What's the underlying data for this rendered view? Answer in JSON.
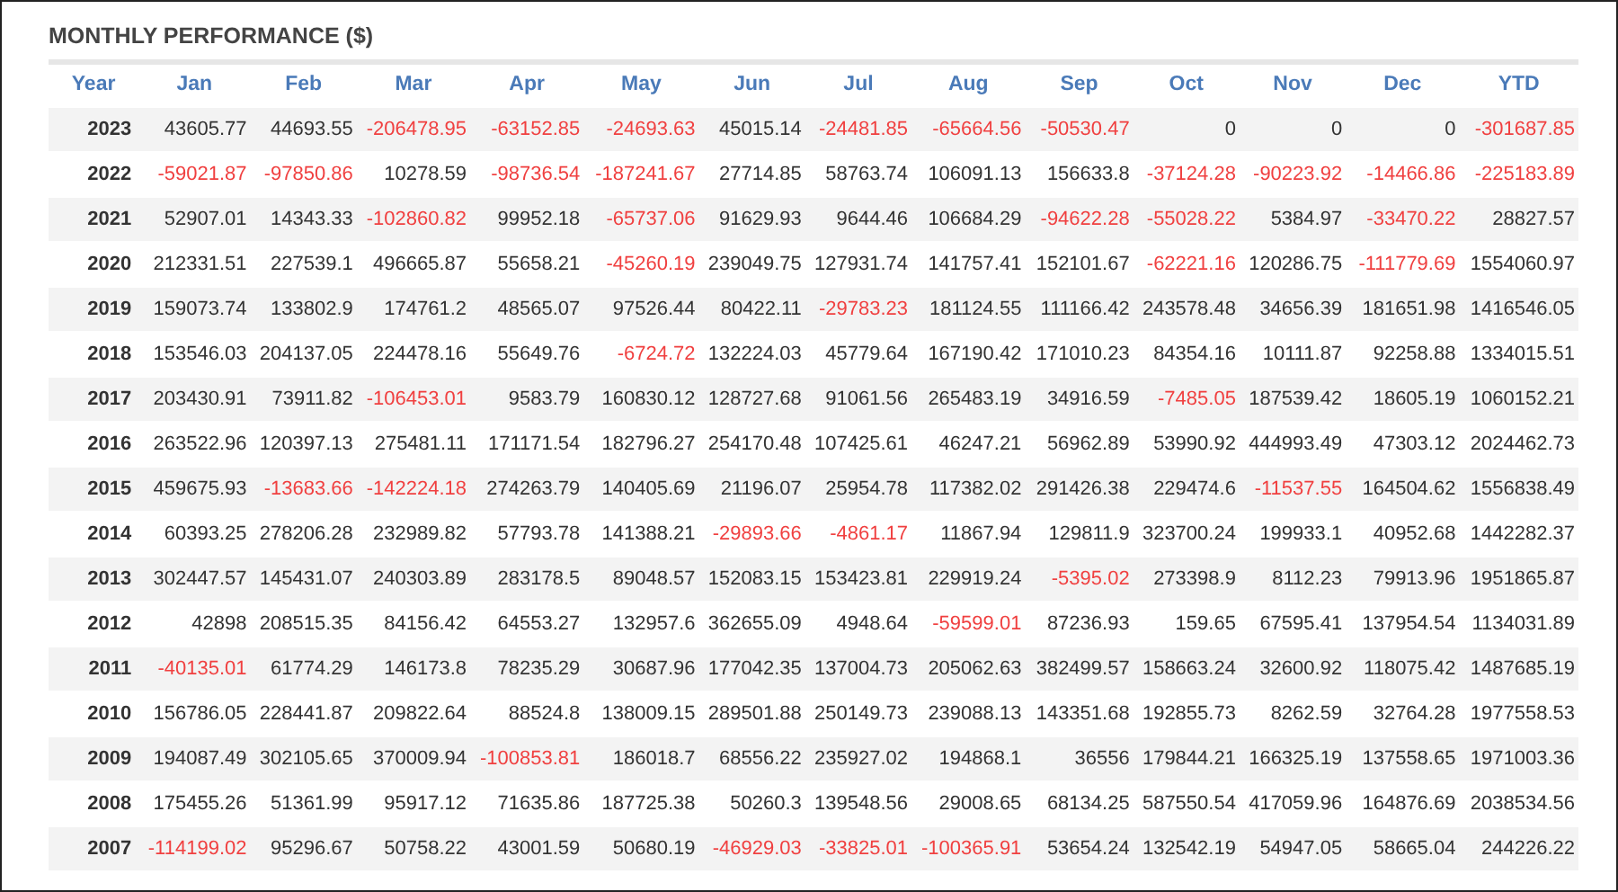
{
  "title": "MONTHLY PERFORMANCE ($)",
  "table": {
    "columns": [
      "Year",
      "Jan",
      "Feb",
      "Mar",
      "Apr",
      "May",
      "Jun",
      "Jul",
      "Aug",
      "Sep",
      "Oct",
      "Nov",
      "Dec",
      "YTD"
    ],
    "rows": [
      {
        "cells": [
          {
            "kind": "year",
            "value": "2023"
          },
          {
            "kind": "amount",
            "value": "43605.77",
            "negative": false
          },
          {
            "kind": "amount",
            "value": "44693.55",
            "negative": false
          },
          {
            "kind": "amount",
            "value": "-206478.95",
            "negative": true
          },
          {
            "kind": "amount",
            "value": "-63152.85",
            "negative": true
          },
          {
            "kind": "amount",
            "value": "-24693.63",
            "negative": true
          },
          {
            "kind": "amount",
            "value": "45015.14",
            "negative": false
          },
          {
            "kind": "amount",
            "value": "-24481.85",
            "negative": true
          },
          {
            "kind": "amount",
            "value": "-65664.56",
            "negative": true
          },
          {
            "kind": "amount",
            "value": "-50530.47",
            "negative": true
          },
          {
            "kind": "amount",
            "value": "0",
            "negative": false
          },
          {
            "kind": "amount",
            "value": "0",
            "negative": false
          },
          {
            "kind": "amount",
            "value": "0",
            "negative": false
          },
          {
            "kind": "amount",
            "value": "-301687.85",
            "negative": true
          }
        ]
      },
      {
        "cells": [
          {
            "kind": "year",
            "value": "2022"
          },
          {
            "kind": "amount",
            "value": "-59021.87",
            "negative": true
          },
          {
            "kind": "amount",
            "value": "-97850.86",
            "negative": true
          },
          {
            "kind": "amount",
            "value": "10278.59",
            "negative": false
          },
          {
            "kind": "amount",
            "value": "-98736.54",
            "negative": true
          },
          {
            "kind": "amount",
            "value": "-187241.67",
            "negative": true
          },
          {
            "kind": "amount",
            "value": "27714.85",
            "negative": false
          },
          {
            "kind": "amount",
            "value": "58763.74",
            "negative": false
          },
          {
            "kind": "amount",
            "value": "106091.13",
            "negative": false
          },
          {
            "kind": "amount",
            "value": "156633.8",
            "negative": false
          },
          {
            "kind": "amount",
            "value": "-37124.28",
            "negative": true
          },
          {
            "kind": "amount",
            "value": "-90223.92",
            "negative": true
          },
          {
            "kind": "amount",
            "value": "-14466.86",
            "negative": true
          },
          {
            "kind": "amount",
            "value": "-225183.89",
            "negative": true
          }
        ]
      },
      {
        "cells": [
          {
            "kind": "year",
            "value": "2021"
          },
          {
            "kind": "amount",
            "value": "52907.01",
            "negative": false
          },
          {
            "kind": "amount",
            "value": "14343.33",
            "negative": false
          },
          {
            "kind": "amount",
            "value": "-102860.82",
            "negative": true
          },
          {
            "kind": "amount",
            "value": "99952.18",
            "negative": false
          },
          {
            "kind": "amount",
            "value": "-65737.06",
            "negative": true
          },
          {
            "kind": "amount",
            "value": "91629.93",
            "negative": false
          },
          {
            "kind": "amount",
            "value": "9644.46",
            "negative": false
          },
          {
            "kind": "amount",
            "value": "106684.29",
            "negative": false
          },
          {
            "kind": "amount",
            "value": "-94622.28",
            "negative": true
          },
          {
            "kind": "amount",
            "value": "-55028.22",
            "negative": true
          },
          {
            "kind": "amount",
            "value": "5384.97",
            "negative": false
          },
          {
            "kind": "amount",
            "value": "-33470.22",
            "negative": true
          },
          {
            "kind": "amount",
            "value": "28827.57",
            "negative": false
          }
        ]
      },
      {
        "cells": [
          {
            "kind": "year",
            "value": "2020"
          },
          {
            "kind": "amount",
            "value": "212331.51",
            "negative": false
          },
          {
            "kind": "amount",
            "value": "227539.1",
            "negative": false
          },
          {
            "kind": "amount",
            "value": "496665.87",
            "negative": false
          },
          {
            "kind": "amount",
            "value": "55658.21",
            "negative": false
          },
          {
            "kind": "amount",
            "value": "-45260.19",
            "negative": true
          },
          {
            "kind": "amount",
            "value": "239049.75",
            "negative": false
          },
          {
            "kind": "amount",
            "value": "127931.74",
            "negative": false
          },
          {
            "kind": "amount",
            "value": "141757.41",
            "negative": false
          },
          {
            "kind": "amount",
            "value": "152101.67",
            "negative": false
          },
          {
            "kind": "amount",
            "value": "-62221.16",
            "negative": true
          },
          {
            "kind": "amount",
            "value": "120286.75",
            "negative": false
          },
          {
            "kind": "amount",
            "value": "-111779.69",
            "negative": true
          },
          {
            "kind": "amount",
            "value": "1554060.97",
            "negative": false
          }
        ]
      },
      {
        "cells": [
          {
            "kind": "year",
            "value": "2019"
          },
          {
            "kind": "amount",
            "value": "159073.74",
            "negative": false
          },
          {
            "kind": "amount",
            "value": "133802.9",
            "negative": false
          },
          {
            "kind": "amount",
            "value": "174761.2",
            "negative": false
          },
          {
            "kind": "amount",
            "value": "48565.07",
            "negative": false
          },
          {
            "kind": "amount",
            "value": "97526.44",
            "negative": false
          },
          {
            "kind": "amount",
            "value": "80422.11",
            "negative": false
          },
          {
            "kind": "amount",
            "value": "-29783.23",
            "negative": true
          },
          {
            "kind": "amount",
            "value": "181124.55",
            "negative": false
          },
          {
            "kind": "amount",
            "value": "111166.42",
            "negative": false
          },
          {
            "kind": "amount",
            "value": "243578.48",
            "negative": false
          },
          {
            "kind": "amount",
            "value": "34656.39",
            "negative": false
          },
          {
            "kind": "amount",
            "value": "181651.98",
            "negative": false
          },
          {
            "kind": "amount",
            "value": "1416546.05",
            "negative": false
          }
        ]
      },
      {
        "cells": [
          {
            "kind": "year",
            "value": "2018"
          },
          {
            "kind": "amount",
            "value": "153546.03",
            "negative": false
          },
          {
            "kind": "amount",
            "value": "204137.05",
            "negative": false
          },
          {
            "kind": "amount",
            "value": "224478.16",
            "negative": false
          },
          {
            "kind": "amount",
            "value": "55649.76",
            "negative": false
          },
          {
            "kind": "amount",
            "value": "-6724.72",
            "negative": true
          },
          {
            "kind": "amount",
            "value": "132224.03",
            "negative": false
          },
          {
            "kind": "amount",
            "value": "45779.64",
            "negative": false
          },
          {
            "kind": "amount",
            "value": "167190.42",
            "negative": false
          },
          {
            "kind": "amount",
            "value": "171010.23",
            "negative": false
          },
          {
            "kind": "amount",
            "value": "84354.16",
            "negative": false
          },
          {
            "kind": "amount",
            "value": "10111.87",
            "negative": false
          },
          {
            "kind": "amount",
            "value": "92258.88",
            "negative": false
          },
          {
            "kind": "amount",
            "value": "1334015.51",
            "negative": false
          }
        ]
      },
      {
        "cells": [
          {
            "kind": "year",
            "value": "2017"
          },
          {
            "kind": "amount",
            "value": "203430.91",
            "negative": false
          },
          {
            "kind": "amount",
            "value": "73911.82",
            "negative": false
          },
          {
            "kind": "amount",
            "value": "-106453.01",
            "negative": true
          },
          {
            "kind": "amount",
            "value": "9583.79",
            "negative": false
          },
          {
            "kind": "amount",
            "value": "160830.12",
            "negative": false
          },
          {
            "kind": "amount",
            "value": "128727.68",
            "negative": false
          },
          {
            "kind": "amount",
            "value": "91061.56",
            "negative": false
          },
          {
            "kind": "amount",
            "value": "265483.19",
            "negative": false
          },
          {
            "kind": "amount",
            "value": "34916.59",
            "negative": false
          },
          {
            "kind": "amount",
            "value": "-7485.05",
            "negative": true
          },
          {
            "kind": "amount",
            "value": "187539.42",
            "negative": false
          },
          {
            "kind": "amount",
            "value": "18605.19",
            "negative": false
          },
          {
            "kind": "amount",
            "value": "1060152.21",
            "negative": false
          }
        ]
      },
      {
        "cells": [
          {
            "kind": "year",
            "value": "2016"
          },
          {
            "kind": "amount",
            "value": "263522.96",
            "negative": false
          },
          {
            "kind": "amount",
            "value": "120397.13",
            "negative": false
          },
          {
            "kind": "amount",
            "value": "275481.11",
            "negative": false
          },
          {
            "kind": "amount",
            "value": "171171.54",
            "negative": false
          },
          {
            "kind": "amount",
            "value": "182796.27",
            "negative": false
          },
          {
            "kind": "amount",
            "value": "254170.48",
            "negative": false
          },
          {
            "kind": "amount",
            "value": "107425.61",
            "negative": false
          },
          {
            "kind": "amount",
            "value": "46247.21",
            "negative": false
          },
          {
            "kind": "amount",
            "value": "56962.89",
            "negative": false
          },
          {
            "kind": "amount",
            "value": "53990.92",
            "negative": false
          },
          {
            "kind": "amount",
            "value": "444993.49",
            "negative": false
          },
          {
            "kind": "amount",
            "value": "47303.12",
            "negative": false
          },
          {
            "kind": "amount",
            "value": "2024462.73",
            "negative": false
          }
        ]
      },
      {
        "cells": [
          {
            "kind": "year",
            "value": "2015"
          },
          {
            "kind": "amount",
            "value": "459675.93",
            "negative": false
          },
          {
            "kind": "amount",
            "value": "-13683.66",
            "negative": true
          },
          {
            "kind": "amount",
            "value": "-142224.18",
            "negative": true
          },
          {
            "kind": "amount",
            "value": "274263.79",
            "negative": false
          },
          {
            "kind": "amount",
            "value": "140405.69",
            "negative": false
          },
          {
            "kind": "amount",
            "value": "21196.07",
            "negative": false
          },
          {
            "kind": "amount",
            "value": "25954.78",
            "negative": false
          },
          {
            "kind": "amount",
            "value": "117382.02",
            "negative": false
          },
          {
            "kind": "amount",
            "value": "291426.38",
            "negative": false
          },
          {
            "kind": "amount",
            "value": "229474.6",
            "negative": false
          },
          {
            "kind": "amount",
            "value": "-11537.55",
            "negative": true
          },
          {
            "kind": "amount",
            "value": "164504.62",
            "negative": false
          },
          {
            "kind": "amount",
            "value": "1556838.49",
            "negative": false
          }
        ]
      },
      {
        "cells": [
          {
            "kind": "year",
            "value": "2014"
          },
          {
            "kind": "amount",
            "value": "60393.25",
            "negative": false
          },
          {
            "kind": "amount",
            "value": "278206.28",
            "negative": false
          },
          {
            "kind": "amount",
            "value": "232989.82",
            "negative": false
          },
          {
            "kind": "amount",
            "value": "57793.78",
            "negative": false
          },
          {
            "kind": "amount",
            "value": "141388.21",
            "negative": false
          },
          {
            "kind": "amount",
            "value": "-29893.66",
            "negative": true
          },
          {
            "kind": "amount",
            "value": "-4861.17",
            "negative": true
          },
          {
            "kind": "amount",
            "value": "11867.94",
            "negative": false
          },
          {
            "kind": "amount",
            "value": "129811.9",
            "negative": false
          },
          {
            "kind": "amount",
            "value": "323700.24",
            "negative": false
          },
          {
            "kind": "amount",
            "value": "199933.1",
            "negative": false
          },
          {
            "kind": "amount",
            "value": "40952.68",
            "negative": false
          },
          {
            "kind": "amount",
            "value": "1442282.37",
            "negative": false
          }
        ]
      },
      {
        "cells": [
          {
            "kind": "year",
            "value": "2013"
          },
          {
            "kind": "amount",
            "value": "302447.57",
            "negative": false
          },
          {
            "kind": "amount",
            "value": "145431.07",
            "negative": false
          },
          {
            "kind": "amount",
            "value": "240303.89",
            "negative": false
          },
          {
            "kind": "amount",
            "value": "283178.5",
            "negative": false
          },
          {
            "kind": "amount",
            "value": "89048.57",
            "negative": false
          },
          {
            "kind": "amount",
            "value": "152083.15",
            "negative": false
          },
          {
            "kind": "amount",
            "value": "153423.81",
            "negative": false
          },
          {
            "kind": "amount",
            "value": "229919.24",
            "negative": false
          },
          {
            "kind": "amount",
            "value": "-5395.02",
            "negative": true
          },
          {
            "kind": "amount",
            "value": "273398.9",
            "negative": false
          },
          {
            "kind": "amount",
            "value": "8112.23",
            "negative": false
          },
          {
            "kind": "amount",
            "value": "79913.96",
            "negative": false
          },
          {
            "kind": "amount",
            "value": "1951865.87",
            "negative": false
          }
        ]
      },
      {
        "cells": [
          {
            "kind": "year",
            "value": "2012"
          },
          {
            "kind": "amount",
            "value": "42898",
            "negative": false
          },
          {
            "kind": "amount",
            "value": "208515.35",
            "negative": false
          },
          {
            "kind": "amount",
            "value": "84156.42",
            "negative": false
          },
          {
            "kind": "amount",
            "value": "64553.27",
            "negative": false
          },
          {
            "kind": "amount",
            "value": "132957.6",
            "negative": false
          },
          {
            "kind": "amount",
            "value": "362655.09",
            "negative": false
          },
          {
            "kind": "amount",
            "value": "4948.64",
            "negative": false
          },
          {
            "kind": "amount",
            "value": "-59599.01",
            "negative": true
          },
          {
            "kind": "amount",
            "value": "87236.93",
            "negative": false
          },
          {
            "kind": "amount",
            "value": "159.65",
            "negative": false
          },
          {
            "kind": "amount",
            "value": "67595.41",
            "negative": false
          },
          {
            "kind": "amount",
            "value": "137954.54",
            "negative": false
          },
          {
            "kind": "amount",
            "value": "1134031.89",
            "negative": false
          }
        ]
      },
      {
        "cells": [
          {
            "kind": "year",
            "value": "2011"
          },
          {
            "kind": "amount",
            "value": "-40135.01",
            "negative": true
          },
          {
            "kind": "amount",
            "value": "61774.29",
            "negative": false
          },
          {
            "kind": "amount",
            "value": "146173.8",
            "negative": false
          },
          {
            "kind": "amount",
            "value": "78235.29",
            "negative": false
          },
          {
            "kind": "amount",
            "value": "30687.96",
            "negative": false
          },
          {
            "kind": "amount",
            "value": "177042.35",
            "negative": false
          },
          {
            "kind": "amount",
            "value": "137004.73",
            "negative": false
          },
          {
            "kind": "amount",
            "value": "205062.63",
            "negative": false
          },
          {
            "kind": "amount",
            "value": "382499.57",
            "negative": false
          },
          {
            "kind": "amount",
            "value": "158663.24",
            "negative": false
          },
          {
            "kind": "amount",
            "value": "32600.92",
            "negative": false
          },
          {
            "kind": "amount",
            "value": "118075.42",
            "negative": false
          },
          {
            "kind": "amount",
            "value": "1487685.19",
            "negative": false
          }
        ]
      },
      {
        "cells": [
          {
            "kind": "year",
            "value": "2010"
          },
          {
            "kind": "amount",
            "value": "156786.05",
            "negative": false
          },
          {
            "kind": "amount",
            "value": "228441.87",
            "negative": false
          },
          {
            "kind": "amount",
            "value": "209822.64",
            "negative": false
          },
          {
            "kind": "amount",
            "value": "88524.8",
            "negative": false
          },
          {
            "kind": "amount",
            "value": "138009.15",
            "negative": false
          },
          {
            "kind": "amount",
            "value": "289501.88",
            "negative": false
          },
          {
            "kind": "amount",
            "value": "250149.73",
            "negative": false
          },
          {
            "kind": "amount",
            "value": "239088.13",
            "negative": false
          },
          {
            "kind": "amount",
            "value": "143351.68",
            "negative": false
          },
          {
            "kind": "amount",
            "value": "192855.73",
            "negative": false
          },
          {
            "kind": "amount",
            "value": "8262.59",
            "negative": false
          },
          {
            "kind": "amount",
            "value": "32764.28",
            "negative": false
          },
          {
            "kind": "amount",
            "value": "1977558.53",
            "negative": false
          }
        ]
      },
      {
        "cells": [
          {
            "kind": "year",
            "value": "2009"
          },
          {
            "kind": "amount",
            "value": "194087.49",
            "negative": false
          },
          {
            "kind": "amount",
            "value": "302105.65",
            "negative": false
          },
          {
            "kind": "amount",
            "value": "370009.94",
            "negative": false
          },
          {
            "kind": "amount",
            "value": "-100853.81",
            "negative": true
          },
          {
            "kind": "amount",
            "value": "186018.7",
            "negative": false
          },
          {
            "kind": "amount",
            "value": "68556.22",
            "negative": false
          },
          {
            "kind": "amount",
            "value": "235927.02",
            "negative": false
          },
          {
            "kind": "amount",
            "value": "194868.1",
            "negative": false
          },
          {
            "kind": "amount",
            "value": "36556",
            "negative": false
          },
          {
            "kind": "amount",
            "value": "179844.21",
            "negative": false
          },
          {
            "kind": "amount",
            "value": "166325.19",
            "negative": false
          },
          {
            "kind": "amount",
            "value": "137558.65",
            "negative": false
          },
          {
            "kind": "amount",
            "value": "1971003.36",
            "negative": false
          }
        ]
      },
      {
        "cells": [
          {
            "kind": "year",
            "value": "2008"
          },
          {
            "kind": "amount",
            "value": "175455.26",
            "negative": false
          },
          {
            "kind": "amount",
            "value": "51361.99",
            "negative": false
          },
          {
            "kind": "amount",
            "value": "95917.12",
            "negative": false
          },
          {
            "kind": "amount",
            "value": "71635.86",
            "negative": false
          },
          {
            "kind": "amount",
            "value": "187725.38",
            "negative": false
          },
          {
            "kind": "amount",
            "value": "50260.3",
            "negative": false
          },
          {
            "kind": "amount",
            "value": "139548.56",
            "negative": false
          },
          {
            "kind": "amount",
            "value": "29008.65",
            "negative": false
          },
          {
            "kind": "amount",
            "value": "68134.25",
            "negative": false
          },
          {
            "kind": "amount",
            "value": "587550.54",
            "negative": false
          },
          {
            "kind": "amount",
            "value": "417059.96",
            "negative": false
          },
          {
            "kind": "amount",
            "value": "164876.69",
            "negative": false
          },
          {
            "kind": "amount",
            "value": "2038534.56",
            "negative": false
          }
        ]
      },
      {
        "cells": [
          {
            "kind": "year",
            "value": "2007"
          },
          {
            "kind": "amount",
            "value": "-114199.02",
            "negative": true
          },
          {
            "kind": "amount",
            "value": "95296.67",
            "negative": false
          },
          {
            "kind": "amount",
            "value": "50758.22",
            "negative": false
          },
          {
            "kind": "amount",
            "value": "43001.59",
            "negative": false
          },
          {
            "kind": "amount",
            "value": "50680.19",
            "negative": false
          },
          {
            "kind": "amount",
            "value": "-46929.03",
            "negative": true
          },
          {
            "kind": "amount",
            "value": "-33825.01",
            "negative": true
          },
          {
            "kind": "amount",
            "value": "-100365.91",
            "negative": true
          },
          {
            "kind": "amount",
            "value": "53654.24",
            "negative": false
          },
          {
            "kind": "amount",
            "value": "132542.19",
            "negative": false
          },
          {
            "kind": "amount",
            "value": "54947.05",
            "negative": false
          },
          {
            "kind": "amount",
            "value": "58665.04",
            "negative": false
          },
          {
            "kind": "amount",
            "value": "244226.22",
            "negative": false
          }
        ]
      }
    ]
  }
}
